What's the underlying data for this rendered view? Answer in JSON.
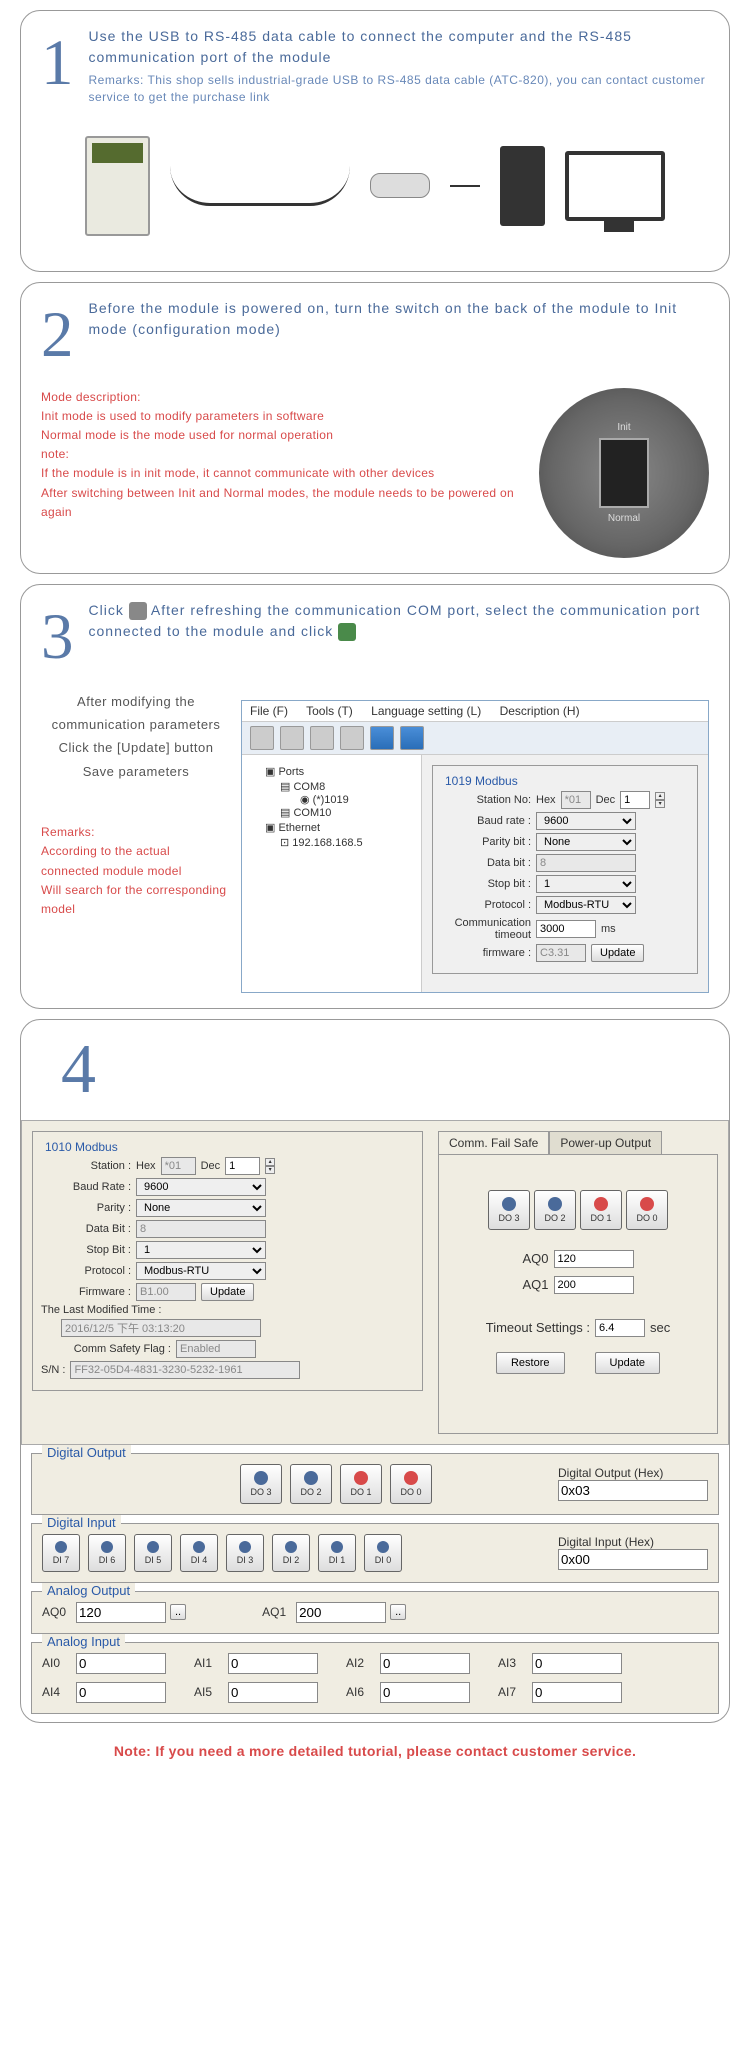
{
  "step1": {
    "num": "1",
    "title": "Use the USB to RS-485 data cable to connect the computer and the RS-485 communication port of the module",
    "remarks": "Remarks: This shop sells industrial-grade USB to RS-485 data cable (ATC-820), you can contact customer service to get the purchase link"
  },
  "step2": {
    "num": "2",
    "title": "Before the module is powered on, turn the switch on the back of the module to Init mode (configuration mode)",
    "mode_desc_header": "Mode description:",
    "mode_init": "Init mode is used to modify parameters in software",
    "mode_normal": "Normal mode is the mode used for normal operation",
    "note_header": "note:",
    "note1": "If the module is in init mode, it cannot communicate with other devices",
    "note2": "After switching between Init and Normal modes, the module needs to be powered on again",
    "switch_labels": {
      "top": "Init",
      "bottom": "Normal"
    }
  },
  "step3": {
    "num": "3",
    "title_a": "Click",
    "title_b": "After refreshing the communication COM port, select the communication port connected to the module and click",
    "side1": "After modifying the communication parameters",
    "side2": "Click the [Update] button",
    "side3": "Save parameters",
    "remarks_header": "Remarks:",
    "remarks1": "According to the actual connected module model",
    "remarks2": "Will search for the corresponding model",
    "menu": {
      "file": "File (F)",
      "tools": "Tools (T)",
      "lang": "Language setting (L)",
      "desc": "Description (H)"
    },
    "tree": {
      "ports": "Ports",
      "com8": "COM8",
      "dev": "(*)1019",
      "com10": "COM10",
      "eth": "Ethernet",
      "ip": "192.168.168.5"
    },
    "config": {
      "title": "1019 Modbus",
      "station_label": "Station No:",
      "hex_label": "Hex",
      "hex": "*01",
      "dec_label": "Dec",
      "dec": "1",
      "baud_label": "Baud rate :",
      "baud": "9600",
      "parity_label": "Parity bit :",
      "parity": "None",
      "databit_label": "Data bit :",
      "databit": "8",
      "stopbit_label": "Stop bit :",
      "stopbit": "1",
      "protocol_label": "Protocol :",
      "protocol": "Modbus-RTU",
      "timeout_label": "Communication timeout",
      "timeout": "3000",
      "ms": "ms",
      "firmware_label": "firmware :",
      "firmware": "C3.31",
      "update": "Update"
    }
  },
  "step4": {
    "num": "4",
    "config": {
      "title": "1010 Modbus",
      "station_label": "Station :",
      "hex_label": "Hex",
      "hex": "*01",
      "dec_label": "Dec",
      "dec": "1",
      "baud_label": "Baud Rate :",
      "baud": "9600",
      "parity_label": "Parity :",
      "parity": "None",
      "databit_label": "Data Bit :",
      "databit": "8",
      "stopbit_label": "Stop Bit :",
      "stopbit": "1",
      "protocol_label": "Protocol :",
      "protocol": "Modbus-RTU",
      "firmware_label": "Firmware :",
      "firmware": "B1.00",
      "update": "Update",
      "lastmod_label": "The Last Modified Time :",
      "lastmod": "2016/12/5 下午 03:13:20",
      "safety_label": "Comm Safety Flag :",
      "safety": "Enabled",
      "sn_label": "S/N :",
      "sn": "FF32-05D4-4831-3230-5232-1961"
    },
    "tabs": {
      "failsafe": "Comm. Fail Safe",
      "powerup": "Power-up Output"
    },
    "failsafe": {
      "do3": "DO 3",
      "do2": "DO 2",
      "do1": "DO 1",
      "do0": "DO 0",
      "aq0_label": "AQ0",
      "aq0": "120",
      "aq1_label": "AQ1",
      "aq1": "200",
      "timeout_label": "Timeout Settings :",
      "timeout": "6.4",
      "sec": "sec",
      "restore": "Restore",
      "update": "Update"
    },
    "digital_output": {
      "title": "Digital Output",
      "do3": "DO 3",
      "do2": "DO 2",
      "do1": "DO 1",
      "do0": "DO 0",
      "hex_label": "Digital Output (Hex)",
      "hex": "0x03"
    },
    "digital_input": {
      "title": "Digital Input",
      "di7": "DI 7",
      "di6": "DI 6",
      "di5": "DI 5",
      "di4": "DI 4",
      "di3": "DI 3",
      "di2": "DI 2",
      "di1": "DI 1",
      "di0": "DI 0",
      "hex_label": "Digital Input (Hex)",
      "hex": "0x00"
    },
    "analog_output": {
      "title": "Analog Output",
      "aq0_label": "AQ0",
      "aq0": "120",
      "aq1_label": "AQ1",
      "aq1": "200",
      "btn": ".."
    },
    "analog_input": {
      "title": "Analog Input",
      "ai0_label": "AI0",
      "ai0": "0",
      "ai1_label": "AI1",
      "ai1": "0",
      "ai2_label": "AI2",
      "ai2": "0",
      "ai3_label": "AI3",
      "ai3": "0",
      "ai4_label": "AI4",
      "ai4": "0",
      "ai5_label": "AI5",
      "ai5": "0",
      "ai6_label": "AI6",
      "ai6": "0",
      "ai7_label": "AI7",
      "ai7": "0"
    }
  },
  "footer": "Note: If you need a more detailed tutorial, please contact customer service."
}
